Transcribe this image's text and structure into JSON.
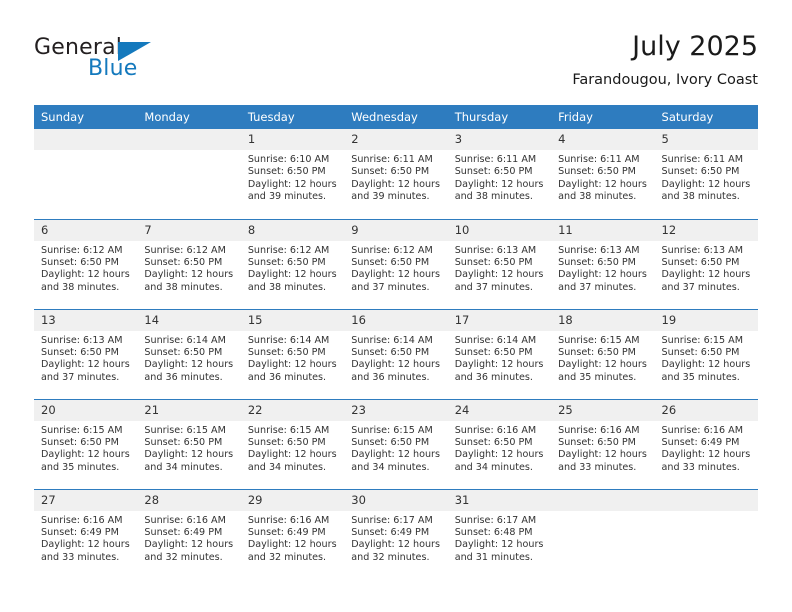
{
  "brand": {
    "name_part1": "General",
    "name_part2": "Blue",
    "triangle_icon": "triangle-icon",
    "accent_color": "#1479bd"
  },
  "header": {
    "title": "July 2025",
    "subtitle": "Farandougou, Ivory Coast"
  },
  "calendar": {
    "header_color": "#2e7cbf",
    "daynum_bg": "#f0f0f0",
    "weekday_headers": [
      "Sunday",
      "Monday",
      "Tuesday",
      "Wednesday",
      "Thursday",
      "Friday",
      "Saturday"
    ],
    "weeks": [
      [
        {
          "day": ""
        },
        {
          "day": ""
        },
        {
          "day": "1",
          "sunrise": "Sunrise: 6:10 AM",
          "sunset": "Sunset: 6:50 PM",
          "daylight_line1": "Daylight: 12 hours",
          "daylight_line2": "and 39 minutes."
        },
        {
          "day": "2",
          "sunrise": "Sunrise: 6:11 AM",
          "sunset": "Sunset: 6:50 PM",
          "daylight_line1": "Daylight: 12 hours",
          "daylight_line2": "and 39 minutes."
        },
        {
          "day": "3",
          "sunrise": "Sunrise: 6:11 AM",
          "sunset": "Sunset: 6:50 PM",
          "daylight_line1": "Daylight: 12 hours",
          "daylight_line2": "and 38 minutes."
        },
        {
          "day": "4",
          "sunrise": "Sunrise: 6:11 AM",
          "sunset": "Sunset: 6:50 PM",
          "daylight_line1": "Daylight: 12 hours",
          "daylight_line2": "and 38 minutes."
        },
        {
          "day": "5",
          "sunrise": "Sunrise: 6:11 AM",
          "sunset": "Sunset: 6:50 PM",
          "daylight_line1": "Daylight: 12 hours",
          "daylight_line2": "and 38 minutes."
        }
      ],
      [
        {
          "day": "6",
          "sunrise": "Sunrise: 6:12 AM",
          "sunset": "Sunset: 6:50 PM",
          "daylight_line1": "Daylight: 12 hours",
          "daylight_line2": "and 38 minutes."
        },
        {
          "day": "7",
          "sunrise": "Sunrise: 6:12 AM",
          "sunset": "Sunset: 6:50 PM",
          "daylight_line1": "Daylight: 12 hours",
          "daylight_line2": "and 38 minutes."
        },
        {
          "day": "8",
          "sunrise": "Sunrise: 6:12 AM",
          "sunset": "Sunset: 6:50 PM",
          "daylight_line1": "Daylight: 12 hours",
          "daylight_line2": "and 38 minutes."
        },
        {
          "day": "9",
          "sunrise": "Sunrise: 6:12 AM",
          "sunset": "Sunset: 6:50 PM",
          "daylight_line1": "Daylight: 12 hours",
          "daylight_line2": "and 37 minutes."
        },
        {
          "day": "10",
          "sunrise": "Sunrise: 6:13 AM",
          "sunset": "Sunset: 6:50 PM",
          "daylight_line1": "Daylight: 12 hours",
          "daylight_line2": "and 37 minutes."
        },
        {
          "day": "11",
          "sunrise": "Sunrise: 6:13 AM",
          "sunset": "Sunset: 6:50 PM",
          "daylight_line1": "Daylight: 12 hours",
          "daylight_line2": "and 37 minutes."
        },
        {
          "day": "12",
          "sunrise": "Sunrise: 6:13 AM",
          "sunset": "Sunset: 6:50 PM",
          "daylight_line1": "Daylight: 12 hours",
          "daylight_line2": "and 37 minutes."
        }
      ],
      [
        {
          "day": "13",
          "sunrise": "Sunrise: 6:13 AM",
          "sunset": "Sunset: 6:50 PM",
          "daylight_line1": "Daylight: 12 hours",
          "daylight_line2": "and 37 minutes."
        },
        {
          "day": "14",
          "sunrise": "Sunrise: 6:14 AM",
          "sunset": "Sunset: 6:50 PM",
          "daylight_line1": "Daylight: 12 hours",
          "daylight_line2": "and 36 minutes."
        },
        {
          "day": "15",
          "sunrise": "Sunrise: 6:14 AM",
          "sunset": "Sunset: 6:50 PM",
          "daylight_line1": "Daylight: 12 hours",
          "daylight_line2": "and 36 minutes."
        },
        {
          "day": "16",
          "sunrise": "Sunrise: 6:14 AM",
          "sunset": "Sunset: 6:50 PM",
          "daylight_line1": "Daylight: 12 hours",
          "daylight_line2": "and 36 minutes."
        },
        {
          "day": "17",
          "sunrise": "Sunrise: 6:14 AM",
          "sunset": "Sunset: 6:50 PM",
          "daylight_line1": "Daylight: 12 hours",
          "daylight_line2": "and 36 minutes."
        },
        {
          "day": "18",
          "sunrise": "Sunrise: 6:15 AM",
          "sunset": "Sunset: 6:50 PM",
          "daylight_line1": "Daylight: 12 hours",
          "daylight_line2": "and 35 minutes."
        },
        {
          "day": "19",
          "sunrise": "Sunrise: 6:15 AM",
          "sunset": "Sunset: 6:50 PM",
          "daylight_line1": "Daylight: 12 hours",
          "daylight_line2": "and 35 minutes."
        }
      ],
      [
        {
          "day": "20",
          "sunrise": "Sunrise: 6:15 AM",
          "sunset": "Sunset: 6:50 PM",
          "daylight_line1": "Daylight: 12 hours",
          "daylight_line2": "and 35 minutes."
        },
        {
          "day": "21",
          "sunrise": "Sunrise: 6:15 AM",
          "sunset": "Sunset: 6:50 PM",
          "daylight_line1": "Daylight: 12 hours",
          "daylight_line2": "and 34 minutes."
        },
        {
          "day": "22",
          "sunrise": "Sunrise: 6:15 AM",
          "sunset": "Sunset: 6:50 PM",
          "daylight_line1": "Daylight: 12 hours",
          "daylight_line2": "and 34 minutes."
        },
        {
          "day": "23",
          "sunrise": "Sunrise: 6:15 AM",
          "sunset": "Sunset: 6:50 PM",
          "daylight_line1": "Daylight: 12 hours",
          "daylight_line2": "and 34 minutes."
        },
        {
          "day": "24",
          "sunrise": "Sunrise: 6:16 AM",
          "sunset": "Sunset: 6:50 PM",
          "daylight_line1": "Daylight: 12 hours",
          "daylight_line2": "and 34 minutes."
        },
        {
          "day": "25",
          "sunrise": "Sunrise: 6:16 AM",
          "sunset": "Sunset: 6:50 PM",
          "daylight_line1": "Daylight: 12 hours",
          "daylight_line2": "and 33 minutes."
        },
        {
          "day": "26",
          "sunrise": "Sunrise: 6:16 AM",
          "sunset": "Sunset: 6:49 PM",
          "daylight_line1": "Daylight: 12 hours",
          "daylight_line2": "and 33 minutes."
        }
      ],
      [
        {
          "day": "27",
          "sunrise": "Sunrise: 6:16 AM",
          "sunset": "Sunset: 6:49 PM",
          "daylight_line1": "Daylight: 12 hours",
          "daylight_line2": "and 33 minutes."
        },
        {
          "day": "28",
          "sunrise": "Sunrise: 6:16 AM",
          "sunset": "Sunset: 6:49 PM",
          "daylight_line1": "Daylight: 12 hours",
          "daylight_line2": "and 32 minutes."
        },
        {
          "day": "29",
          "sunrise": "Sunrise: 6:16 AM",
          "sunset": "Sunset: 6:49 PM",
          "daylight_line1": "Daylight: 12 hours",
          "daylight_line2": "and 32 minutes."
        },
        {
          "day": "30",
          "sunrise": "Sunrise: 6:17 AM",
          "sunset": "Sunset: 6:49 PM",
          "daylight_line1": "Daylight: 12 hours",
          "daylight_line2": "and 32 minutes."
        },
        {
          "day": "31",
          "sunrise": "Sunrise: 6:17 AM",
          "sunset": "Sunset: 6:48 PM",
          "daylight_line1": "Daylight: 12 hours",
          "daylight_line2": "and 31 minutes."
        },
        {
          "day": ""
        },
        {
          "day": ""
        }
      ]
    ]
  }
}
